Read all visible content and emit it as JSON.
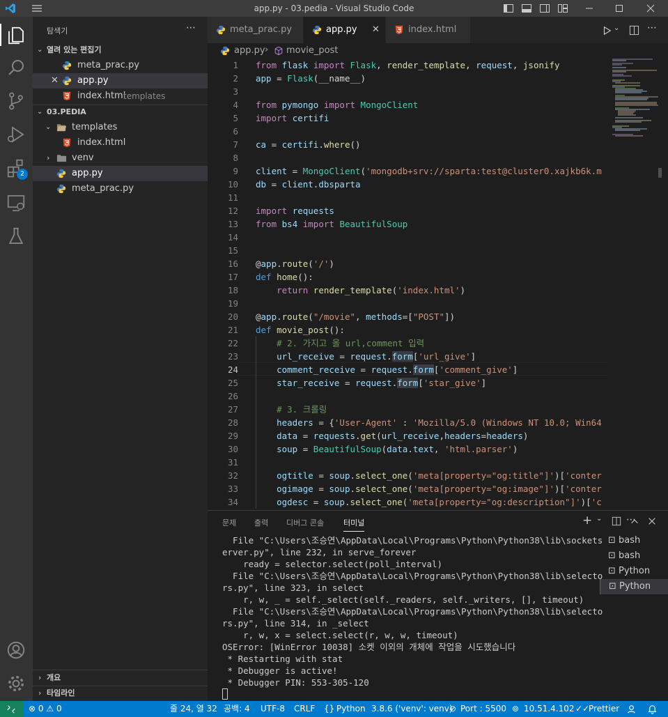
{
  "window": {
    "title": "app.py - 03.pedia - Visual Studio Code"
  },
  "activity_bar": {
    "extensions_badge": "2"
  },
  "sidebar": {
    "header": "탐색기",
    "open_editors_title": "열려 있는 편집기",
    "open_editors": [
      {
        "name": "meta_prac.py",
        "detail": ""
      },
      {
        "name": "app.py",
        "detail": ""
      },
      {
        "name": "index.html",
        "detail": "templates"
      }
    ],
    "project_title": "03.PEDIA",
    "tree": [
      {
        "name": "templates"
      },
      {
        "name": "index.html"
      },
      {
        "name": "venv"
      },
      {
        "name": "app.py"
      },
      {
        "name": "meta_prac.py"
      }
    ],
    "outline_title": "개요",
    "timeline_title": "타임라인"
  },
  "tabs": [
    {
      "label": "meta_prac.py"
    },
    {
      "label": "app.py"
    },
    {
      "label": "index.html"
    }
  ],
  "breadcrumb": {
    "file": "app.py",
    "symbol": "movie_post"
  },
  "editor": {
    "line_numbers": [
      "1",
      "2",
      "3",
      "4",
      "5",
      "6",
      "7",
      "8",
      "9",
      "10",
      "11",
      "12",
      "13",
      "14",
      "15",
      "16",
      "17",
      "18",
      "19",
      "20",
      "21",
      "22",
      "23",
      "24",
      "25",
      "26",
      "27",
      "28",
      "29",
      "30",
      "31",
      "32",
      "33",
      "34"
    ],
    "lines": [
      "from flask import Flask, render_template, request, jsonify",
      "app = Flask(__name__)",
      "",
      "from pymongo import MongoClient",
      "import certifi",
      "",
      "ca = certifi.where()",
      "",
      "client = MongoClient('mongodb+srv://sparta:test@cluster0.xajkb6k.m",
      "db = client.dbsparta",
      "",
      "import requests",
      "from bs4 import BeautifulSoup",
      "",
      "",
      "@app.route('/')",
      "def home():",
      "    return render_template('index.html')",
      "",
      "@app.route(\"/movie\", methods=[\"POST\"])",
      "def movie_post():",
      "    # 2. 가지고 올 url,comment 입력",
      "    url_receive = request.form['url_give']",
      "    comment_receive = request.form['comment_give']",
      "    star_receive = request.form['star_give']",
      "",
      "    # 3. 크롤링",
      "    headers = {'User-Agent' : 'Mozilla/5.0 (Windows NT 10.0; Win64",
      "    data = requests.get(url_receive,headers=headers)",
      "    soup = BeautifulSoup(data.text, 'html.parser')",
      "",
      "    ogtitle = soup.select_one('meta[property=\"og:title\"]')['conter",
      "    ogimage = soup.select_one('meta[property=\"og:image\"]')['conter",
      "    ogdesc = soup.select_one('meta[property=\"og:description\"]')['c"
    ]
  },
  "panel": {
    "tabs": [
      "문제",
      "출력",
      "디버그 콘솔",
      "터미널"
    ],
    "terminal_lines": [
      "  File \"C:\\Users\\조승연\\AppData\\Local\\Programs\\Python\\Python38\\lib\\sockets",
      "erver.py\", line 232, in serve_forever",
      "    ready = selector.select(poll_interval)",
      "  File \"C:\\Users\\조승연\\AppData\\Local\\Programs\\Python\\Python38\\lib\\selecto",
      "rs.py\", line 323, in select",
      "    r, w, _ = self._select(self._readers, self._writers, [], timeout)",
      "  File \"C:\\Users\\조승연\\AppData\\Local\\Programs\\Python\\Python38\\lib\\selecto",
      "rs.py\", line 314, in _select",
      "    r, w, x = select.select(r, w, w, timeout)",
      "OSError: [WinError 10038] 소켓 이외의 개체에 작업을 시도했습니다",
      " * Restarting with stat",
      " * Debugger is active!",
      " * Debugger PIN: 553-305-120"
    ],
    "terminals": [
      "bash",
      "bash",
      "Python",
      "Python"
    ]
  },
  "status": {
    "errors": "0",
    "warnings": "0",
    "cursor": "줄 24, 열 32",
    "spaces": "공백: 4",
    "encoding": "UTF-8",
    "eol": "CRLF",
    "language": "Python",
    "interpreter": "3.8.6 ('venv': venv)",
    "port": "Port : 5500",
    "ip": "10.51.4.102",
    "prettier": "Prettier"
  }
}
